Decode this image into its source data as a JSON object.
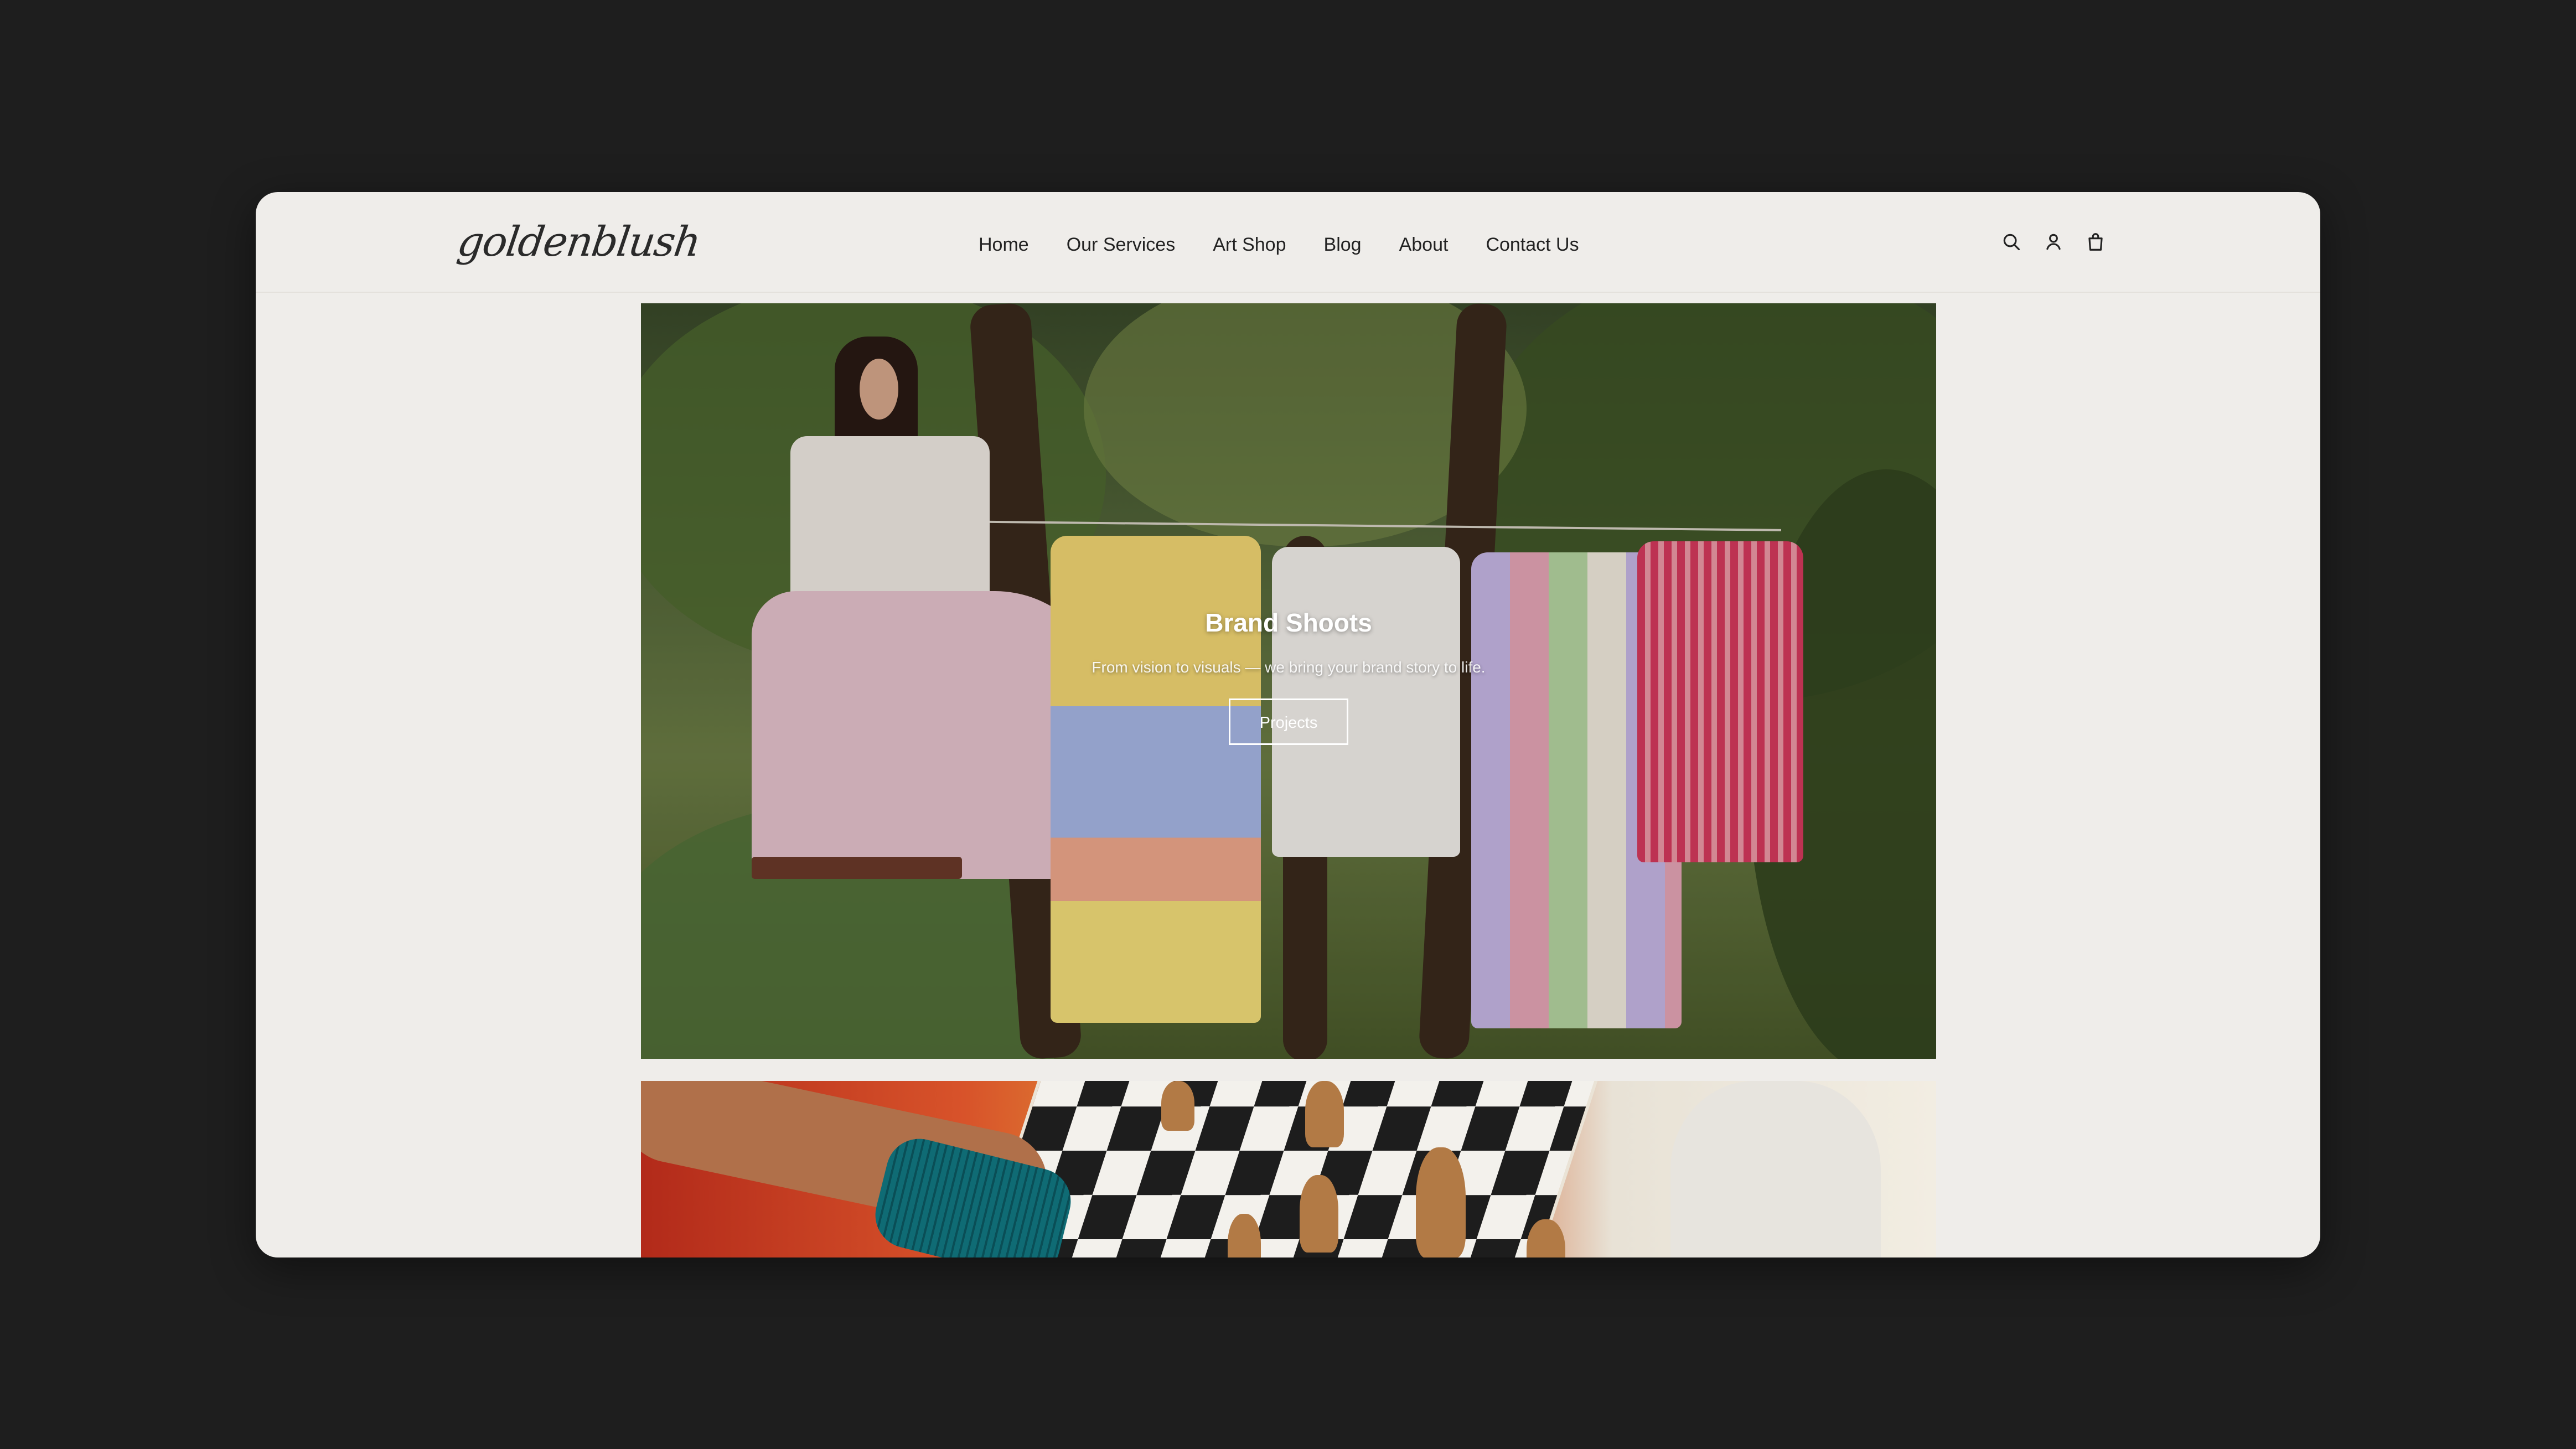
{
  "brand": {
    "logo_text": "goldenblush"
  },
  "nav": {
    "items": [
      {
        "label": "Home"
      },
      {
        "label": "Our Services"
      },
      {
        "label": "Art Shop"
      },
      {
        "label": "Blog"
      },
      {
        "label": "About"
      },
      {
        "label": "Contact Us"
      }
    ]
  },
  "header_icons": [
    {
      "icon": "search-icon"
    },
    {
      "icon": "account-icon"
    },
    {
      "icon": "cart-icon"
    }
  ],
  "hero": {
    "title": "Brand Shoots",
    "subtitle": "From vision to visuals — we bring your brand story to life.",
    "button_label": "Projects"
  },
  "colors": {
    "page_background": "#1e1e1e",
    "window_background": "#efedea",
    "text": "#222222"
  }
}
